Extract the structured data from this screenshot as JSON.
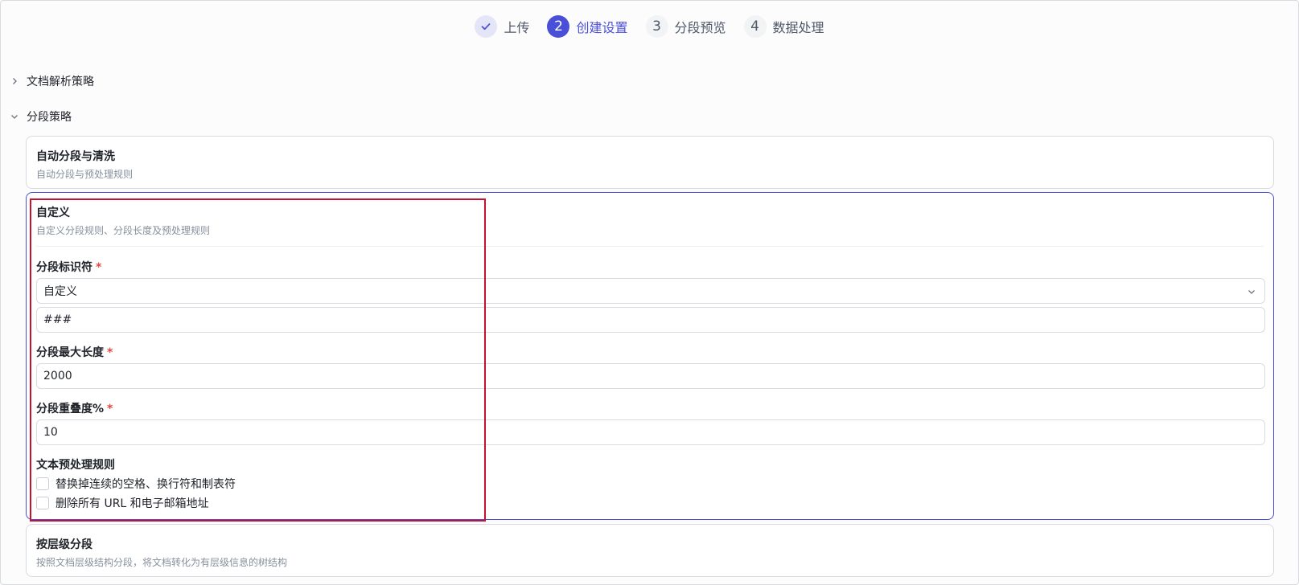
{
  "steps": [
    {
      "number": "✓",
      "label": "上传",
      "state": "done"
    },
    {
      "number": "2",
      "label": "创建设置",
      "state": "active"
    },
    {
      "number": "3",
      "label": "分段预览",
      "state": "todo"
    },
    {
      "number": "4",
      "label": "数据处理",
      "state": "todo"
    }
  ],
  "sections": {
    "parse_strategy": "文档解析策略",
    "chunk_strategy": "分段策略"
  },
  "cards": {
    "auto": {
      "title": "自动分段与清洗",
      "desc": "自动分段与预处理规则"
    },
    "custom": {
      "title": "自定义",
      "desc": "自定义分段规则、分段长度及预处理规则",
      "separator_label": "分段标识符",
      "separator_select": "自定义",
      "separator_value": "###",
      "max_length_label": "分段最大长度",
      "max_length_value": "2000",
      "overlap_label": "分段重叠度%",
      "overlap_value": "10",
      "preprocess_label": "文本预处理规则",
      "rule_1": "替换掉连续的空格、换行符和制表符",
      "rule_2": "删除所有 URL 和电子邮箱地址",
      "required_mark": "*"
    },
    "hierarchy": {
      "title": "按层级分段",
      "desc": "按照文档层级结构分段，将文档转化为有层级信息的树结构"
    }
  },
  "colors": {
    "accent": "#4a4fd8",
    "highlight": "#c4122f",
    "required": "#e5483d"
  },
  "icons": {
    "done": "check-icon",
    "collapsed": "chevron-right-icon",
    "expanded": "chevron-down-icon"
  }
}
